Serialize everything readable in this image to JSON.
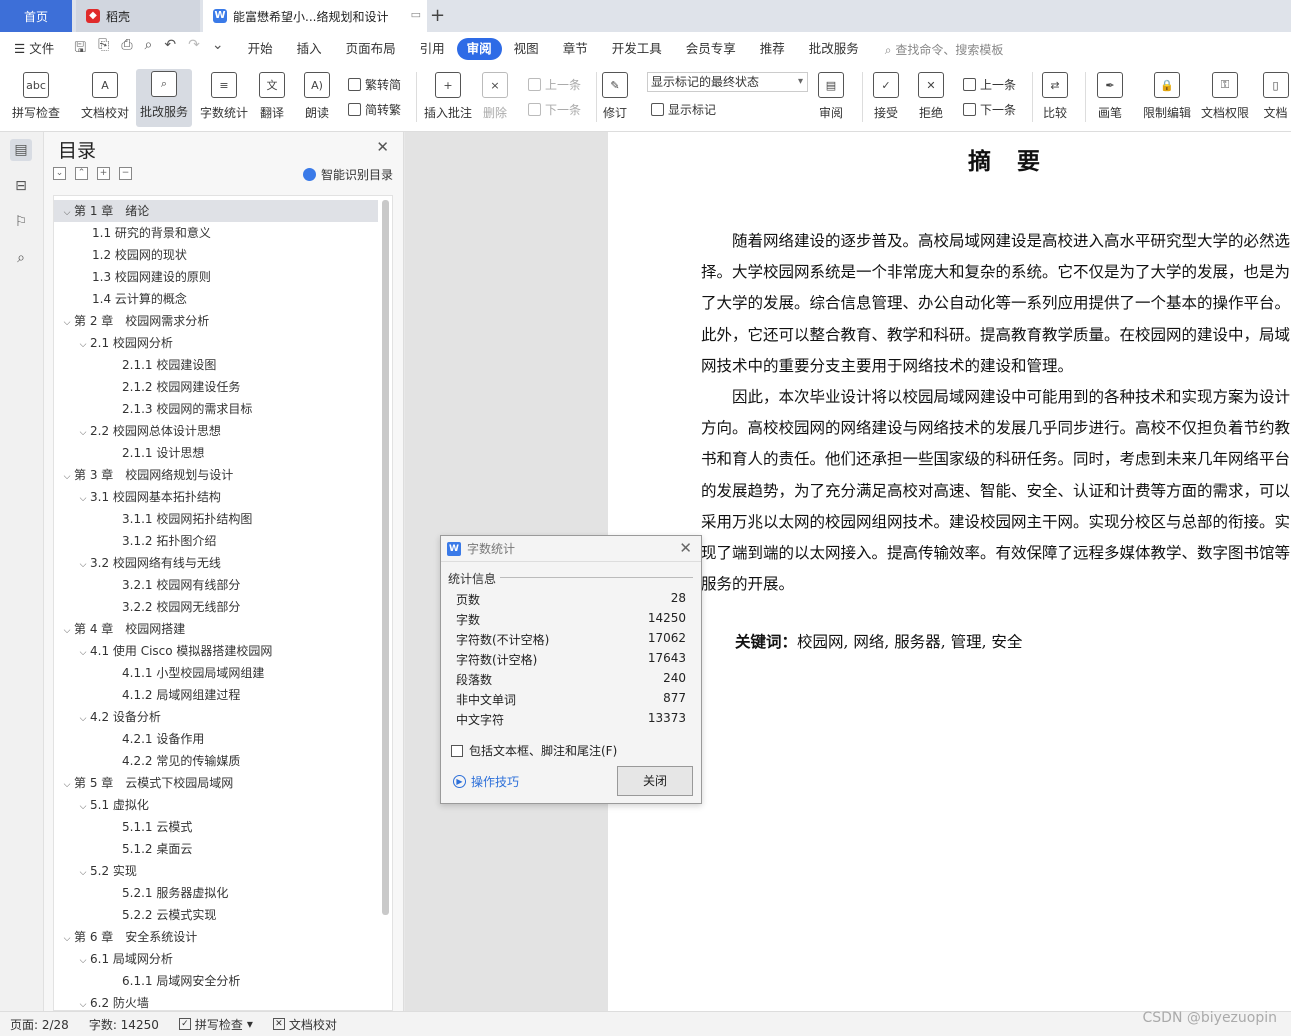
{
  "tabs": {
    "home": "首页",
    "daoke": "稻壳",
    "doc": "能富懋希望小...络规划和设计"
  },
  "menu": {
    "file": "文件",
    "items": [
      "开始",
      "插入",
      "页面布局",
      "引用",
      "审阅",
      "视图",
      "章节",
      "开发工具",
      "会员专享",
      "推荐",
      "批改服务"
    ],
    "active": "审阅",
    "search": "查找命令、搜索模板"
  },
  "ribbon": {
    "spell_check": "拼写检查",
    "doc_check": "文档校对",
    "correction_service": "批改服务",
    "word_count": "字数统计",
    "translate": "翻译",
    "read_aloud": "朗读",
    "trad_to_simp": "繁转简",
    "simp_to_trad": "简转繁",
    "insert_comment": "插入批注",
    "delete": "删除",
    "prev": "上一条",
    "next": "下一条",
    "revise": "修订",
    "markup_state": "显示标记的最终状态",
    "show_markup": "显示标记",
    "review": "审阅",
    "accept": "接受",
    "reject": "拒绝",
    "prev2": "上一条",
    "next2": "下一条",
    "compare": "比较",
    "pen": "画笔",
    "restrict_edit": "限制编辑",
    "doc_permission": "文档权限",
    "doc_cut": "文档"
  },
  "nav": {
    "title": "目录",
    "smart": "智能识别目录",
    "toc": [
      {
        "text": "第 1 章　绪论",
        "level": 1,
        "arrow": "⌄"
      },
      {
        "text": "1.1  研究的背景和意义",
        "level": 2,
        "arrow": ""
      },
      {
        "text": "1.2  校园网的现状",
        "level": 2,
        "arrow": ""
      },
      {
        "text": "1.3  校园网建设的原则",
        "level": 2,
        "arrow": ""
      },
      {
        "text": "1.4  云计算的概念",
        "level": 2,
        "arrow": ""
      },
      {
        "text": "第 2 章　校园网需求分析",
        "level": 1,
        "arrow": "⌄"
      },
      {
        "text": "2.1  校园网分析",
        "level": 2,
        "arrow": "⌄"
      },
      {
        "text": "2.1.1  校园建设图",
        "level": 3,
        "arrow": ""
      },
      {
        "text": "2.1.2  校园网建设任务",
        "level": 3,
        "arrow": ""
      },
      {
        "text": "2.1.3  校园网的需求目标",
        "level": 3,
        "arrow": ""
      },
      {
        "text": "2.2  校园网总体设计思想",
        "level": 2,
        "arrow": "⌄"
      },
      {
        "text": "2.1.1  设计思想",
        "level": 3,
        "arrow": ""
      },
      {
        "text": "第 3 章　校园网络规划与设计",
        "level": 1,
        "arrow": "⌄"
      },
      {
        "text": "3.1  校园网基本拓扑结构",
        "level": 2,
        "arrow": "⌄"
      },
      {
        "text": "3.1.1  校园网拓扑结构图",
        "level": 3,
        "arrow": ""
      },
      {
        "text": "3.1.2  拓扑图介绍",
        "level": 3,
        "arrow": ""
      },
      {
        "text": "3.2  校园网络有线与无线",
        "level": 2,
        "arrow": "⌄"
      },
      {
        "text": "3.2.1  校园网有线部分",
        "level": 3,
        "arrow": ""
      },
      {
        "text": "3.2.2  校园网无线部分",
        "level": 3,
        "arrow": ""
      },
      {
        "text": "第 4 章　校园网搭建",
        "level": 1,
        "arrow": "⌄"
      },
      {
        "text": "4.1  使用 Cisco 模拟器搭建校园网",
        "level": 2,
        "arrow": "⌄"
      },
      {
        "text": "4.1.1  小型校园局域网组建",
        "level": 3,
        "arrow": ""
      },
      {
        "text": "4.1.2  局域网组建过程",
        "level": 3,
        "arrow": ""
      },
      {
        "text": "4.2  设备分析",
        "level": 2,
        "arrow": "⌄"
      },
      {
        "text": "4.2.1 设备作用",
        "level": 3,
        "arrow": ""
      },
      {
        "text": "4.2.2 常见的传输媒质",
        "level": 3,
        "arrow": ""
      },
      {
        "text": "第 5 章　云模式下校园局域网",
        "level": 1,
        "arrow": "⌄"
      },
      {
        "text": "5.1  虚拟化",
        "level": 2,
        "arrow": "⌄"
      },
      {
        "text": "5.1.1  云模式",
        "level": 3,
        "arrow": ""
      },
      {
        "text": "5.1.2  桌面云",
        "level": 3,
        "arrow": ""
      },
      {
        "text": "5.2  实现",
        "level": 2,
        "arrow": "⌄"
      },
      {
        "text": "5.2.1  服务器虚拟化",
        "level": 3,
        "arrow": ""
      },
      {
        "text": "5.2.2  云模式实现",
        "level": 3,
        "arrow": ""
      },
      {
        "text": "第 6 章　安全系统设计",
        "level": 1,
        "arrow": "⌄"
      },
      {
        "text": "6.1  局域网分析",
        "level": 2,
        "arrow": "⌄"
      },
      {
        "text": "6.1.1  局域网安全分析",
        "level": 3,
        "arrow": ""
      },
      {
        "text": "6.2  防火墙",
        "level": 2,
        "arrow": "⌄"
      }
    ]
  },
  "document": {
    "title": "摘要",
    "paragraph_lines": [
      "　　随着网络建设的逐步普及。高校局域网建设是高校进入高水平研究型大学的必然选",
      "择。大学校园网系统是一个非常庞大和复杂的系统。它不仅是为了大学的发展，也是为",
      "了大学的发展。综合信息管理、办公自动化等一系列应用提供了一个基本的操作平台。",
      "此外，它还可以整合教育、教学和科研。提高教育教学质量。在校园网的建设中，局域",
      "网技术中的重要分支主要用于网络技术的建设和管理。",
      "　　因此，本次毕业设计将以校园局域网建设中可能用到的各种技术和实现方案为设计",
      "方向。高校校园网的网络建设与网络技术的发展几乎同步进行。高校不仅担负着节约教",
      "书和育人的责任。他们还承担一些国家级的科研任务。同时，考虑到未来几年网络平台",
      "的发展趋势，为了充分满足高校对高速、智能、安全、认证和计费等方面的需求，可以",
      "采用万兆以太网的校园网组网技术。建设校园网主干网。实现分校区与总部的衔接。实",
      "现了端到端的以太网接入。提高传输效率。有效保障了远程多媒体教学、数字图书馆等",
      "服务的开展。"
    ],
    "keywords_label": "关键词：",
    "keywords": "校园网, 网络, 服务器, 管理, 安全"
  },
  "dialog": {
    "title": "字数统计",
    "section": "统计信息",
    "stats": [
      {
        "label": "页数",
        "value": "28"
      },
      {
        "label": "字数",
        "value": "14250"
      },
      {
        "label": "字符数(不计空格)",
        "value": "17062"
      },
      {
        "label": "字符数(计空格)",
        "value": "17643"
      },
      {
        "label": "段落数",
        "value": "240"
      },
      {
        "label": "非中文单词",
        "value": "877"
      },
      {
        "label": "中文字符",
        "value": "13373"
      }
    ],
    "include_label": "包括文本框、脚注和尾注(F)",
    "tips": "操作技巧",
    "close": "关闭"
  },
  "status": {
    "page": "页面: 2/28",
    "words": "字数: 14250",
    "spell": "拼写检查",
    "doc_check": "文档校对"
  },
  "watermark": "CSDN @biyezuopin"
}
